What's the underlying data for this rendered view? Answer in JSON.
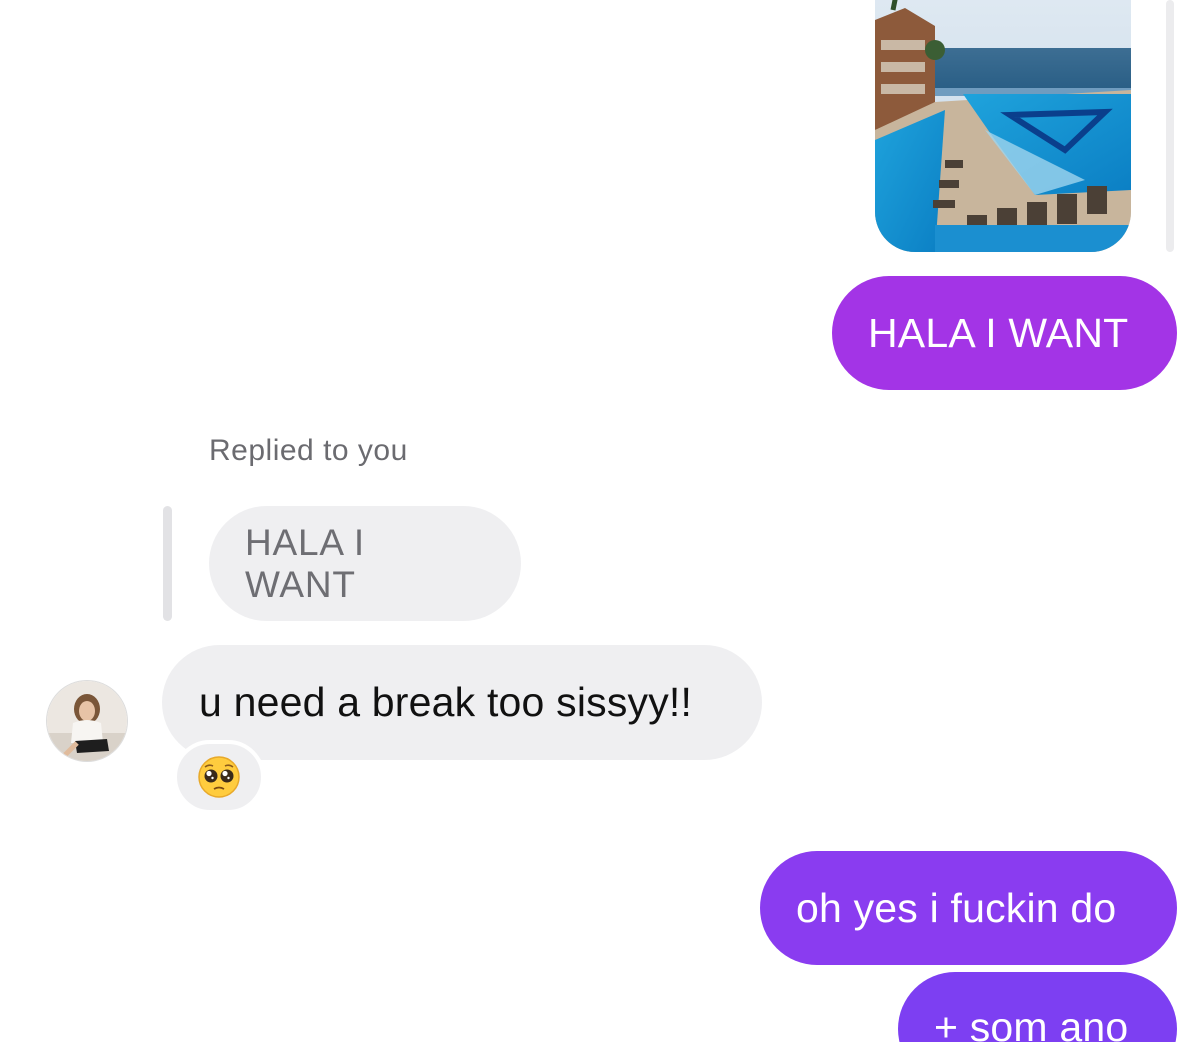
{
  "conversation": {
    "shared_photo": {
      "icon": "resort-pool-photo"
    },
    "messages": [
      {
        "direction": "outgoing",
        "text": "HALA I WANT"
      },
      {
        "direction": "incoming",
        "reply_label": "Replied to you",
        "quoted_text": "HALA I WANT",
        "text": "u need a break too sissyy!!",
        "reaction_icon": "pleading-face-emoji"
      },
      {
        "direction": "outgoing",
        "text": "oh yes i fuckin do"
      },
      {
        "direction": "outgoing",
        "text": "+ som ano"
      }
    ]
  },
  "colors": {
    "outgoing_bubble_top": "#a334e6",
    "outgoing_bubble_bottom": "#7d3ff2",
    "incoming_bubble": "#efeff1",
    "background": "#ffffff"
  }
}
